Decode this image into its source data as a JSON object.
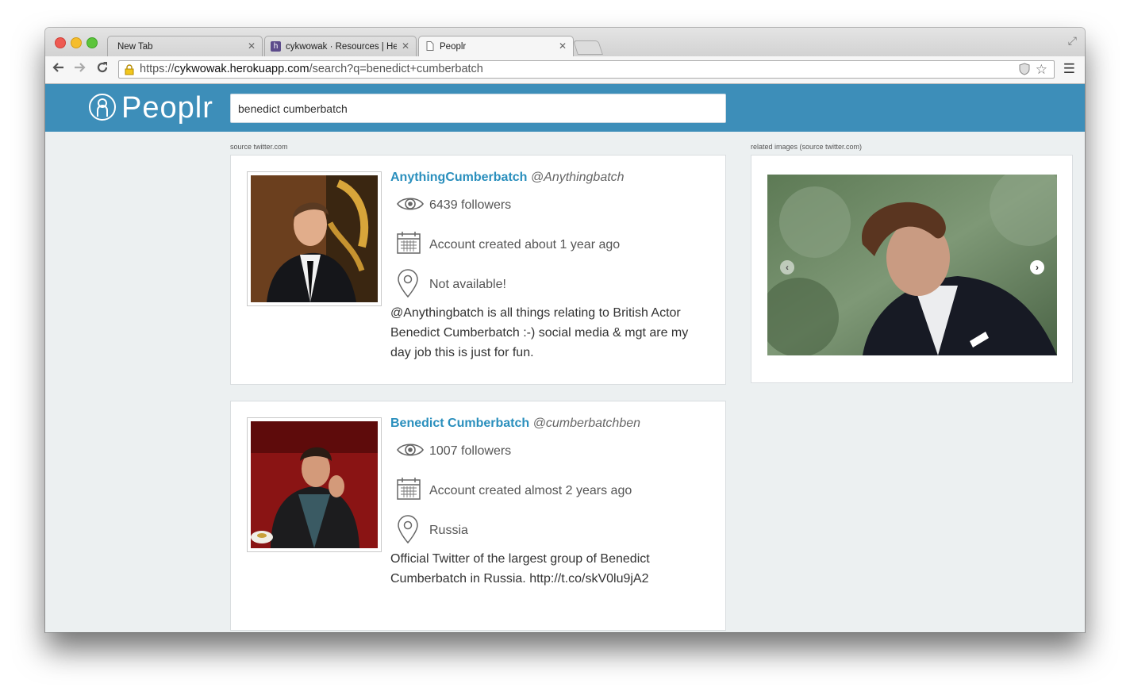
{
  "browser": {
    "tabs": [
      {
        "label": "New Tab"
      },
      {
        "label": "cykwowak · Resources | Heroku"
      },
      {
        "label": "Peoplr"
      }
    ],
    "url": {
      "scheme": "https://",
      "host": "cykwowak.herokuapp.com",
      "path": "/search?q=benedict+cumberbatch"
    }
  },
  "header": {
    "logo_text": "Peoplr",
    "search_value": "benedict cumberbatch"
  },
  "results": {
    "source_label": "source twitter.com",
    "items": [
      {
        "display_name": "AnythingCumberbatch",
        "handle": "@Anythingbatch",
        "followers": "6439 followers",
        "created": "Account created about 1 year ago",
        "location": "Not available!",
        "bio": "@Anythingbatch is all things relating to British Actor Benedict Cumberbatch :-) social media & mgt are my day job this is just for fun."
      },
      {
        "display_name": "Benedict Cumberbatch",
        "handle": "@cumberbatchben",
        "followers": "1007 followers",
        "created": "Account created almost 2 years ago",
        "location": "Russia",
        "bio": "Official Twitter of the largest group of Benedict Cumberbatch in Russia. http://t.co/skV0lu9jA2"
      }
    ]
  },
  "related": {
    "label": "related images (source twitter.com)"
  },
  "icons": {
    "followers": "eye-icon",
    "created": "calendar-icon",
    "location": "map-pin-icon"
  },
  "colors": {
    "header": "#3d8eb9",
    "link": "#2a8fbd",
    "background": "#ecf0f1"
  }
}
